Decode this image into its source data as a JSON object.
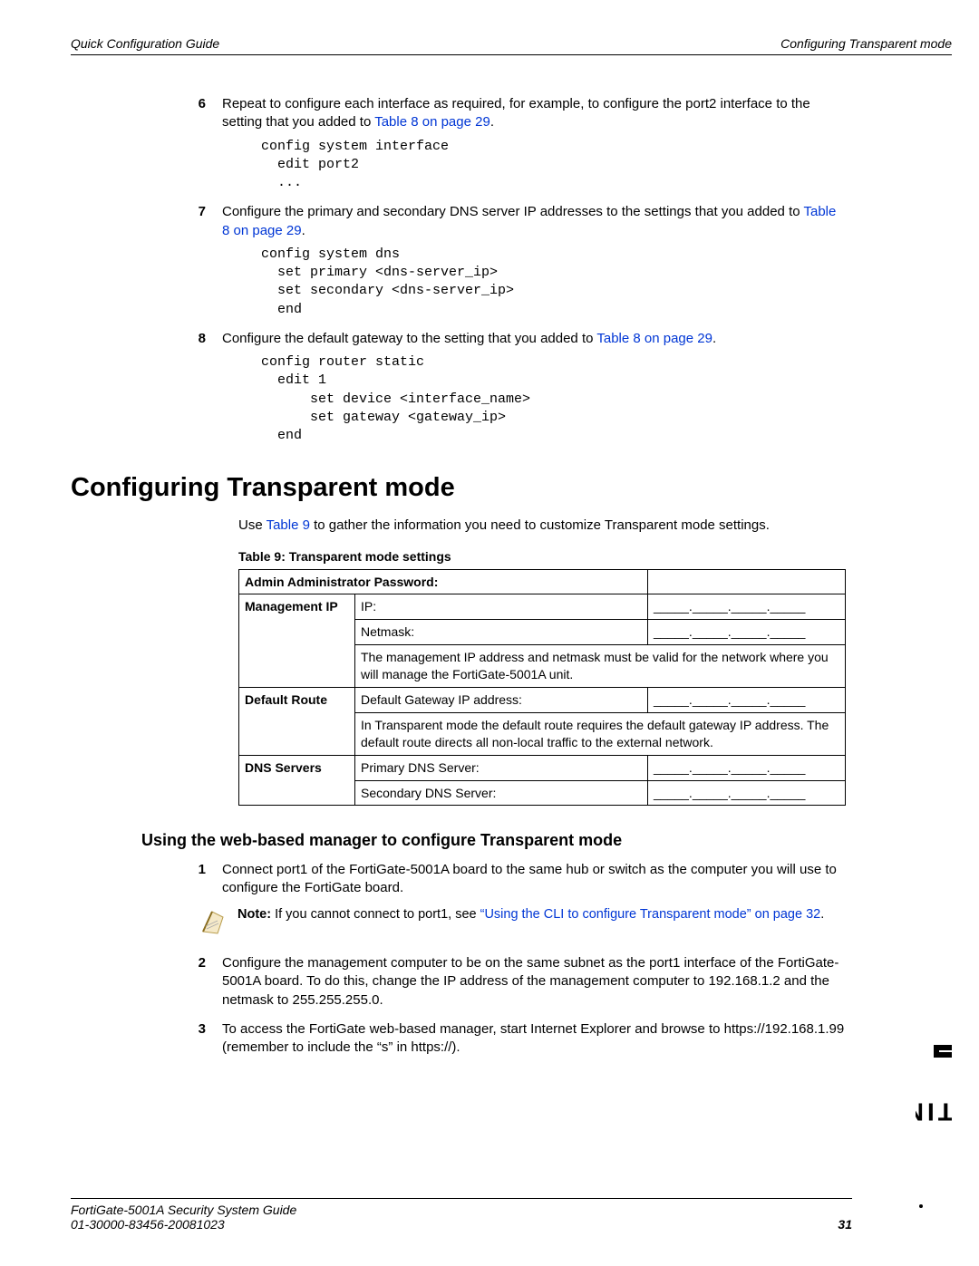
{
  "header": {
    "left": "Quick Configuration Guide",
    "right": "Configuring Transparent mode"
  },
  "steps_a": [
    {
      "num": "6",
      "text_before": "Repeat to configure each interface as required, for example, to configure the port2 interface to the setting that you added to ",
      "link": "Table 8 on page 29",
      "text_after": ".",
      "code": "config system interface\n  edit port2\n  ..."
    },
    {
      "num": "7",
      "text_before": "Configure the primary and secondary DNS server IP addresses to the settings that you added to ",
      "link": "Table 8 on page 29",
      "text_after": ".",
      "code": "config system dns\n  set primary <dns-server_ip>\n  set secondary <dns-server_ip>\n  end"
    },
    {
      "num": "8",
      "text_before": "Configure the default gateway to the setting that you added to ",
      "link": "Table 8 on page 29",
      "text_after": ".",
      "code": "config router static\n  edit 1\n      set device <interface_name>\n      set gateway <gateway_ip>\n  end"
    }
  ],
  "section_heading": "Configuring Transparent mode",
  "section_intro_before": "Use ",
  "section_intro_link": "Table 9",
  "section_intro_after": " to gather the information you need to customize Transparent mode settings.",
  "table_caption": "Table 9: Transparent mode settings",
  "table": {
    "admin_pw_label": "Admin Administrator Password:",
    "mgmt_ip_label": "Management IP",
    "ip_label": "IP:",
    "netmask_label": "Netmask:",
    "mgmt_note": "The management IP address and netmask must be valid for the network where you will manage the FortiGate-5001A unit.",
    "default_route_label": "Default Route",
    "gw_label": "Default Gateway IP address:",
    "route_note": "In Transparent mode the default route requires the default gateway IP address. The default route directs all non-local traffic to the external network.",
    "dns_label": "DNS Servers",
    "pdns_label": "Primary DNS Server:",
    "sdns_label": "Secondary DNS Server:",
    "ip_placeholder": "_____._____._____._____"
  },
  "sub_heading": "Using the web-based manager to configure Transparent mode",
  "steps_b": [
    {
      "num": "1",
      "text": "Connect port1 of the FortiGate-5001A board to the same hub or switch as the computer you will use to configure the FortiGate board."
    }
  ],
  "note": {
    "bold": "Note:",
    "before": " If you cannot connect to port1, see ",
    "link": "“Using the CLI to configure Transparent mode” on page 32",
    "after": "."
  },
  "steps_c": [
    {
      "num": "2",
      "text": "Configure the management computer to be on the same subnet as the port1 interface of the FortiGate-5001A board. To do this, change the IP address of the management computer to 192.168.1.2 and the netmask to 255.255.255.0."
    },
    {
      "num": "3",
      "text": "To access the FortiGate web-based manager, start Internet Explorer and browse to https://192.168.1.99 (remember to include the “s” in https://)."
    }
  ],
  "footer": {
    "line1": "FortiGate-5001A   Security System Guide",
    "line2": "01-30000-83456-20081023",
    "page": "31"
  },
  "brand": "F RTINET"
}
